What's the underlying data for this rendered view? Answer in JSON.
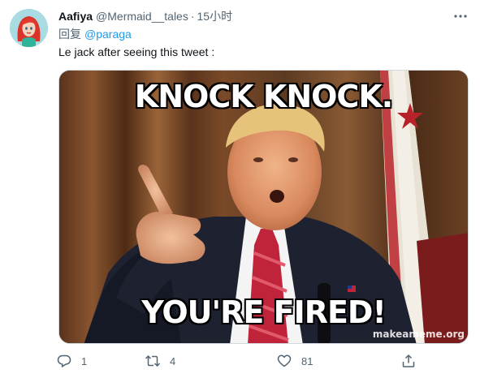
{
  "tweet": {
    "display_name": "Aafiya",
    "handle": "@Mermaid__tales",
    "separator": "·",
    "time": "15小时",
    "reply_prefix": "回复",
    "reply_to": "@paraga",
    "text": "Le jack after seeing this tweet :"
  },
  "media": {
    "top_caption": "KNOCK KNOCK.",
    "bottom_caption": "YOU'RE FIRED!",
    "watermark": "makeameme.org"
  },
  "actions": {
    "reply_count": "1",
    "retweet_count": "4",
    "like_count": "81"
  },
  "icons": {
    "more": "more-icon",
    "reply": "reply-icon",
    "retweet": "retweet-icon",
    "like": "heart-icon",
    "share": "share-icon"
  },
  "colors": {
    "link": "#1d9bf0",
    "secondary_text": "#536471",
    "primary_text": "#0f1419",
    "avatar_bg": "#a9dbe3"
  }
}
